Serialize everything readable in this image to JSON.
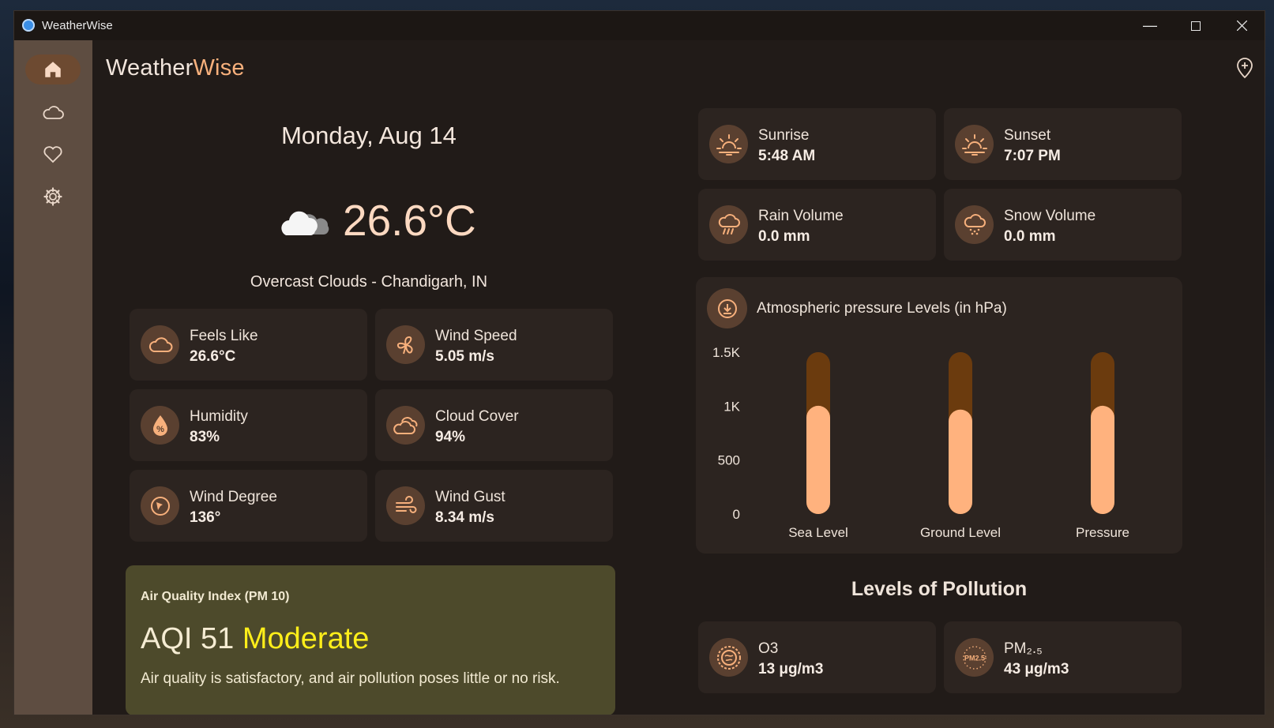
{
  "window": {
    "title": "WeatherWise"
  },
  "brand": {
    "part1": "Weather",
    "part2": "Wise"
  },
  "nav": [
    "home",
    "cloud",
    "favorites",
    "settings"
  ],
  "current": {
    "date": "Monday, Aug 14",
    "temperature": "26.6°C",
    "condition": "Overcast Clouds  -  Chandigarh, IN"
  },
  "stats": [
    {
      "label": "Feels Like",
      "value": "26.6°C",
      "icon": "cloud-icon"
    },
    {
      "label": "Wind Speed",
      "value": "5.05 m/s",
      "icon": "fan-icon"
    },
    {
      "label": "Humidity",
      "value": "83%",
      "icon": "humidity-drop-icon"
    },
    {
      "label": "Cloud Cover",
      "value": "94%",
      "icon": "clouds-icon"
    },
    {
      "label": "Wind Degree",
      "value": "136°",
      "icon": "compass-icon"
    },
    {
      "label": "Wind Gust",
      "value": "8.34 m/s",
      "icon": "wind-icon"
    }
  ],
  "sun_rain": [
    {
      "label": "Sunrise",
      "value": "5:48 AM",
      "icon": "sunrise-icon"
    },
    {
      "label": "Sunset",
      "value": "7:07 PM",
      "icon": "sunset-icon"
    },
    {
      "label": "Rain Volume",
      "value": "0.0 mm",
      "icon": "rain-icon"
    },
    {
      "label": "Snow Volume",
      "value": "0.0 mm",
      "icon": "snow-icon"
    }
  ],
  "aqi": {
    "heading": "Air Quality Index (PM 10)",
    "value": "AQI 51",
    "level": "Moderate",
    "description": "Air quality is satisfactory, and air pollution poses little or no risk."
  },
  "pollution": {
    "title": "Levels of Pollution",
    "items": [
      {
        "label": "O3",
        "value": "13 μg/m3",
        "icon": "ozone-icon"
      },
      {
        "label": "PM₂.₅",
        "value": "43 μg/m3",
        "icon": "pm25-icon",
        "icon_text": "PM2.5"
      }
    ]
  },
  "colors": {
    "accent": "#f7b07c",
    "bar_fill": "#ffb27e",
    "bar_track": "#6b3b0e",
    "aqi_moderate": "#ffee1a"
  },
  "chart_data": {
    "type": "bar",
    "title": "Atmospheric pressure Levels (in hPa)",
    "categories": [
      "Sea Level",
      "Ground Level",
      "Pressure"
    ],
    "values": [
      1003,
      968,
      1003
    ],
    "ylim": [
      0,
      1500
    ],
    "yticks": [
      "1.5K",
      "1K",
      "500",
      "0"
    ],
    "grid": false
  }
}
